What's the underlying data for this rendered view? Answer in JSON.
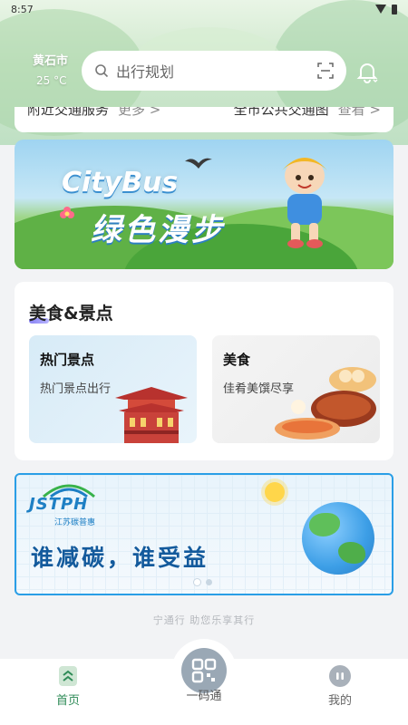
{
  "status_bar": {
    "time": "8:57"
  },
  "header": {
    "city": "黄石市",
    "temperature": "25 °C",
    "search_placeholder": "出行规划"
  },
  "quick_links": {
    "left_label": "附近交通服务",
    "left_more": "更多 >",
    "right_label": "全市公共交通图",
    "right_more": "查看 >"
  },
  "banner_citybus": {
    "title": "CityBus",
    "subtitle": "绿色漫步"
  },
  "food_scenic": {
    "title": "美食&景点",
    "tiles": [
      {
        "title": "热门景点",
        "subtitle": "热门景点出行"
      },
      {
        "title": "美食",
        "subtitle": "佳肴美馔尽享"
      }
    ]
  },
  "banner_jstph": {
    "logo": "JSTPH",
    "logo_sub": "江苏碳普惠",
    "slogan": "谁减碳，谁受益"
  },
  "footer_slogan": "宁通行 助您乐享其行",
  "tab_bar": {
    "home": "首页",
    "code": "一码通",
    "me": "我的"
  },
  "colors": {
    "accent_green": "#2e8b57",
    "banner_border": "#2a9ee6"
  }
}
